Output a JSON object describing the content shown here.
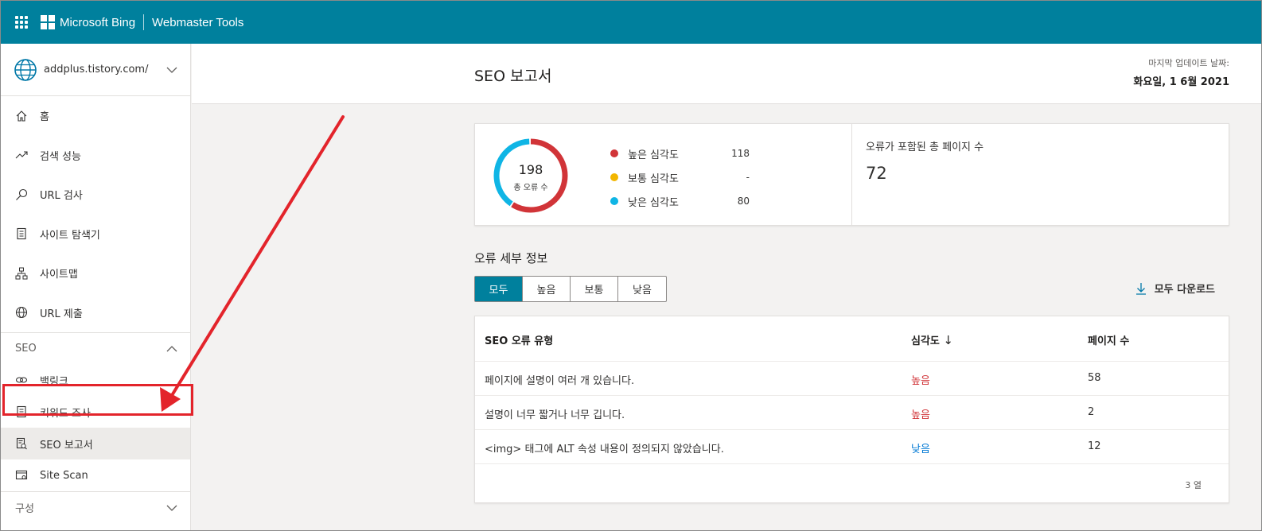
{
  "header": {
    "brand": "Microsoft Bing",
    "product": "Webmaster Tools"
  },
  "sidebar": {
    "site": "addplus.tistory.com/",
    "items": [
      {
        "label": "홈"
      },
      {
        "label": "검색 성능"
      },
      {
        "label": "URL 검사"
      },
      {
        "label": "사이트 탐색기"
      },
      {
        "label": "사이트맵"
      },
      {
        "label": "URL 제출"
      }
    ],
    "seo_section": "SEO",
    "seo_items": [
      {
        "label": "백링크"
      },
      {
        "label": "키워드 조사"
      },
      {
        "label": "SEO 보고서"
      },
      {
        "label": "Site Scan"
      }
    ],
    "config_section": "구성"
  },
  "page": {
    "title": "SEO 보고서",
    "last_update_label": "마지막 업데이트 날짜:",
    "last_update_date": "화요일, 1 6월 2021"
  },
  "summary": {
    "total_errors": "198",
    "total_errors_label": "총 오류 수",
    "legend": [
      {
        "label": "높은 심각도",
        "value": "118",
        "color": "#d13438"
      },
      {
        "label": "보통 심각도",
        "value": "-",
        "color": "#f2b600"
      },
      {
        "label": "낮은 심각도",
        "value": "80",
        "color": "#0fb5e5"
      }
    ],
    "pages_with_errors_label": "오류가 포함된 총 페이지 수",
    "pages_with_errors": "72"
  },
  "details": {
    "title": "오류 세부 정보",
    "tabs": [
      "모두",
      "높음",
      "보통",
      "낮음"
    ],
    "active_tab": "모두",
    "download_label": "모두 다운로드",
    "columns": [
      "SEO 오류 유형",
      "심각도",
      "페이지 수"
    ],
    "sort_indicator": "↓",
    "rows": [
      {
        "type": "페이지에 설명이 여러 개 있습니다.",
        "severity": "높음",
        "pages": "58"
      },
      {
        "type": "설명이 너무 짧거나 너무 깁니다.",
        "severity": "높음",
        "pages": "2"
      },
      {
        "type": "<img> 태그에 ALT 속성 내용이 정의되지 않았습니다.",
        "severity": "낮음",
        "pages": "12"
      }
    ],
    "row_count": "3 열"
  },
  "colors": {
    "accent": "#00809d",
    "annotation": "#e3242b"
  }
}
